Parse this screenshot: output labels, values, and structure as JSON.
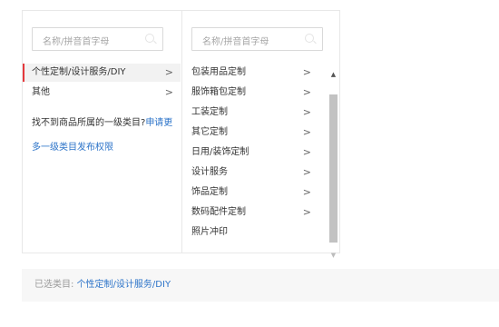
{
  "left": {
    "search_placeholder": "名称/拼音首字母",
    "items": [
      {
        "label": "个性定制/设计服务/DIY",
        "chevron": ">"
      },
      {
        "label": "其他",
        "chevron": ">"
      }
    ],
    "note_text": "找不到商品所属的一级类目?",
    "note_link1": "申请更",
    "note_link2": "多一级类目发布权限"
  },
  "right": {
    "search_placeholder": "名称/拼音首字母",
    "items": [
      {
        "label": "包装用品定制",
        "chevron": ">"
      },
      {
        "label": "服饰箱包定制",
        "chevron": ">"
      },
      {
        "label": "工装定制",
        "chevron": ">"
      },
      {
        "label": "其它定制",
        "chevron": ">"
      },
      {
        "label": "日用/装饰定制",
        "chevron": ">"
      },
      {
        "label": "设计服务",
        "chevron": ">"
      },
      {
        "label": "饰品定制",
        "chevron": ">"
      },
      {
        "label": "数码配件定制",
        "chevron": ">"
      },
      {
        "label": "照片冲印",
        "chevron": ""
      }
    ],
    "scroll_up": "▲",
    "scroll_down": "▼"
  },
  "selected": {
    "label": "已选类目:",
    "value": "个性定制/设计服务/DIY"
  }
}
